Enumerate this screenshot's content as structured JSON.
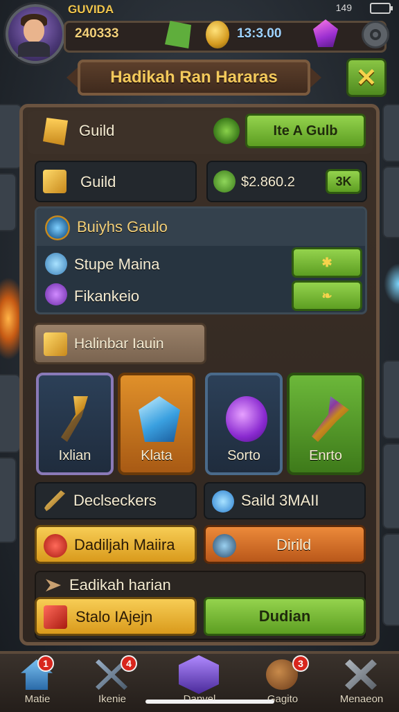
{
  "status_bar": {
    "time": "149"
  },
  "player": {
    "name": "GUVIDA"
  },
  "resources": {
    "gold": "240333",
    "coins": "13:3.00"
  },
  "title_banner": {
    "title": "Hadikah Ran Hararas",
    "close_label": "✕"
  },
  "guild_header": {
    "label": "Guild",
    "action_label": "Ite A Gulb"
  },
  "guild_row": {
    "label": "Guild",
    "amount": "$2.860.2",
    "button_label": "3K"
  },
  "guild_section": {
    "title": "Buiyhs Gaulo",
    "items": [
      {
        "label": "Stupe Maina",
        "button_icon": "star"
      },
      {
        "label": "Fikankeio",
        "button_icon": "leaf"
      }
    ]
  },
  "inventory_tab": {
    "label": "Halinbar Iauin"
  },
  "tiles": [
    {
      "label": "Ixlian",
      "icon": "golden-hammer"
    },
    {
      "label": "Klata",
      "icon": "blue-crystal"
    },
    {
      "label": "Sorto",
      "icon": "purple-orb"
    },
    {
      "label": "Enrto",
      "icon": "green-hammer"
    }
  ],
  "info_rows": [
    {
      "label": "Declseckers",
      "icon": "sword"
    },
    {
      "label": "Saild 3MAII",
      "icon": "blue-orb"
    }
  ],
  "action_rows": [
    {
      "label": "Dadiljah Maiira",
      "icon": "red-shield"
    },
    {
      "label": "Dirild",
      "icon": "steel-orb"
    }
  ],
  "bottom_section": {
    "title": "Eadikah harian",
    "left_button": "Stalo IAjejn",
    "right_button": "Dudian"
  },
  "bottom_nav": [
    {
      "label": "Matie",
      "badge": "1",
      "icon": "home"
    },
    {
      "label": "Ikenie",
      "badge": "4",
      "icon": "crossed-swords"
    },
    {
      "label": "Danvel",
      "badge": "",
      "icon": "crystal-shield"
    },
    {
      "label": "Gagito",
      "badge": "3",
      "icon": "barrel"
    },
    {
      "label": "Menaeon",
      "badge": "",
      "icon": "crossed-tools"
    }
  ],
  "colors": {
    "accent_gold": "#f3c95b",
    "button_green": "#5d9e22",
    "button_orange": "#b9581a",
    "badge_red": "#d8261d"
  }
}
